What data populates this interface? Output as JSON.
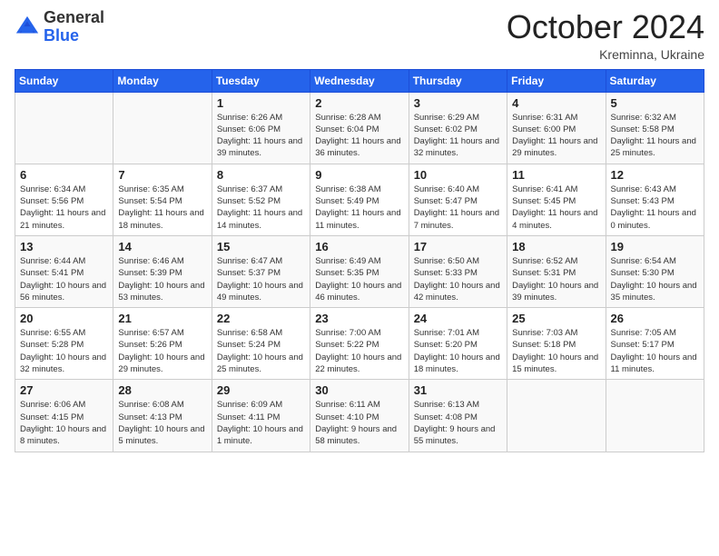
{
  "header": {
    "logo_general": "General",
    "logo_blue": "Blue",
    "month_year": "October 2024",
    "location": "Kreminna, Ukraine"
  },
  "days_of_week": [
    "Sunday",
    "Monday",
    "Tuesday",
    "Wednesday",
    "Thursday",
    "Friday",
    "Saturday"
  ],
  "weeks": [
    [
      {
        "day": "",
        "content": ""
      },
      {
        "day": "",
        "content": ""
      },
      {
        "day": "1",
        "content": "Sunrise: 6:26 AM\nSunset: 6:06 PM\nDaylight: 11 hours and 39 minutes."
      },
      {
        "day": "2",
        "content": "Sunrise: 6:28 AM\nSunset: 6:04 PM\nDaylight: 11 hours and 36 minutes."
      },
      {
        "day": "3",
        "content": "Sunrise: 6:29 AM\nSunset: 6:02 PM\nDaylight: 11 hours and 32 minutes."
      },
      {
        "day": "4",
        "content": "Sunrise: 6:31 AM\nSunset: 6:00 PM\nDaylight: 11 hours and 29 minutes."
      },
      {
        "day": "5",
        "content": "Sunrise: 6:32 AM\nSunset: 5:58 PM\nDaylight: 11 hours and 25 minutes."
      }
    ],
    [
      {
        "day": "6",
        "content": "Sunrise: 6:34 AM\nSunset: 5:56 PM\nDaylight: 11 hours and 21 minutes."
      },
      {
        "day": "7",
        "content": "Sunrise: 6:35 AM\nSunset: 5:54 PM\nDaylight: 11 hours and 18 minutes."
      },
      {
        "day": "8",
        "content": "Sunrise: 6:37 AM\nSunset: 5:52 PM\nDaylight: 11 hours and 14 minutes."
      },
      {
        "day": "9",
        "content": "Sunrise: 6:38 AM\nSunset: 5:49 PM\nDaylight: 11 hours and 11 minutes."
      },
      {
        "day": "10",
        "content": "Sunrise: 6:40 AM\nSunset: 5:47 PM\nDaylight: 11 hours and 7 minutes."
      },
      {
        "day": "11",
        "content": "Sunrise: 6:41 AM\nSunset: 5:45 PM\nDaylight: 11 hours and 4 minutes."
      },
      {
        "day": "12",
        "content": "Sunrise: 6:43 AM\nSunset: 5:43 PM\nDaylight: 11 hours and 0 minutes."
      }
    ],
    [
      {
        "day": "13",
        "content": "Sunrise: 6:44 AM\nSunset: 5:41 PM\nDaylight: 10 hours and 56 minutes."
      },
      {
        "day": "14",
        "content": "Sunrise: 6:46 AM\nSunset: 5:39 PM\nDaylight: 10 hours and 53 minutes."
      },
      {
        "day": "15",
        "content": "Sunrise: 6:47 AM\nSunset: 5:37 PM\nDaylight: 10 hours and 49 minutes."
      },
      {
        "day": "16",
        "content": "Sunrise: 6:49 AM\nSunset: 5:35 PM\nDaylight: 10 hours and 46 minutes."
      },
      {
        "day": "17",
        "content": "Sunrise: 6:50 AM\nSunset: 5:33 PM\nDaylight: 10 hours and 42 minutes."
      },
      {
        "day": "18",
        "content": "Sunrise: 6:52 AM\nSunset: 5:31 PM\nDaylight: 10 hours and 39 minutes."
      },
      {
        "day": "19",
        "content": "Sunrise: 6:54 AM\nSunset: 5:30 PM\nDaylight: 10 hours and 35 minutes."
      }
    ],
    [
      {
        "day": "20",
        "content": "Sunrise: 6:55 AM\nSunset: 5:28 PM\nDaylight: 10 hours and 32 minutes."
      },
      {
        "day": "21",
        "content": "Sunrise: 6:57 AM\nSunset: 5:26 PM\nDaylight: 10 hours and 29 minutes."
      },
      {
        "day": "22",
        "content": "Sunrise: 6:58 AM\nSunset: 5:24 PM\nDaylight: 10 hours and 25 minutes."
      },
      {
        "day": "23",
        "content": "Sunrise: 7:00 AM\nSunset: 5:22 PM\nDaylight: 10 hours and 22 minutes."
      },
      {
        "day": "24",
        "content": "Sunrise: 7:01 AM\nSunset: 5:20 PM\nDaylight: 10 hours and 18 minutes."
      },
      {
        "day": "25",
        "content": "Sunrise: 7:03 AM\nSunset: 5:18 PM\nDaylight: 10 hours and 15 minutes."
      },
      {
        "day": "26",
        "content": "Sunrise: 7:05 AM\nSunset: 5:17 PM\nDaylight: 10 hours and 11 minutes."
      }
    ],
    [
      {
        "day": "27",
        "content": "Sunrise: 6:06 AM\nSunset: 4:15 PM\nDaylight: 10 hours and 8 minutes."
      },
      {
        "day": "28",
        "content": "Sunrise: 6:08 AM\nSunset: 4:13 PM\nDaylight: 10 hours and 5 minutes."
      },
      {
        "day": "29",
        "content": "Sunrise: 6:09 AM\nSunset: 4:11 PM\nDaylight: 10 hours and 1 minute."
      },
      {
        "day": "30",
        "content": "Sunrise: 6:11 AM\nSunset: 4:10 PM\nDaylight: 9 hours and 58 minutes."
      },
      {
        "day": "31",
        "content": "Sunrise: 6:13 AM\nSunset: 4:08 PM\nDaylight: 9 hours and 55 minutes."
      },
      {
        "day": "",
        "content": ""
      },
      {
        "day": "",
        "content": ""
      }
    ]
  ]
}
